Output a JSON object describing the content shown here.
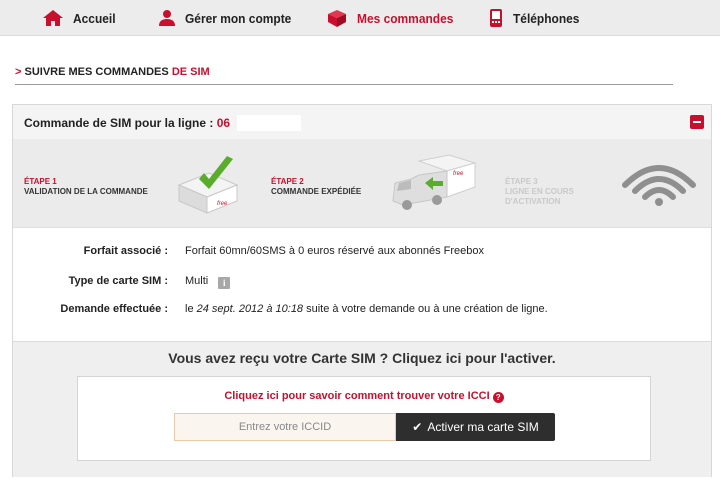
{
  "nav": {
    "items": [
      {
        "label": "Accueil",
        "icon": "home-icon"
      },
      {
        "label": "Gérer mon compte",
        "icon": "user-icon"
      },
      {
        "label": "Mes commandes",
        "icon": "box-icon"
      },
      {
        "label": "Téléphones",
        "icon": "phone-icon"
      }
    ],
    "active": "Mes commandes"
  },
  "section": {
    "arrow": ">",
    "title_main": "SUIVRE MES COMMANDES",
    "title_red": "DE SIM"
  },
  "panel": {
    "title": "Commande de SIM pour la ligne :",
    "line_number": "06",
    "steps": [
      {
        "num": "ÉTAPE 1",
        "lines": [
          "VALIDATION DE LA COMMANDE"
        ],
        "state": "done"
      },
      {
        "num": "ÉTAPE 2",
        "lines": [
          "COMMANDE EXPÉDIÉE"
        ],
        "state": "current"
      },
      {
        "num": "ÉTAPE 3",
        "lines": [
          "LIGNE EN COURS",
          "D'ACTIVATION"
        ],
        "state": "pending"
      }
    ],
    "details": {
      "forfait_label": "Forfait associé :",
      "forfait_value": "Forfait 60mn/60SMS à 0 euros réservé aux abonnés Freebox",
      "type_label": "Type de carte SIM :",
      "type_value": "Multi",
      "demande_label": "Demande effectuée :",
      "demande_prefix": "le",
      "demande_date": "24 sept. 2012 à 10:18",
      "demande_suffix": "suite à votre demande ou à une création de ligne."
    },
    "activation": {
      "title": "Vous avez reçu votre Carte SIM ? Cliquez ici pour l'activer.",
      "icci_link": "Cliquez ici pour savoir comment trouver votre ICCI",
      "iccid_placeholder": "Entrez votre ICCID",
      "button_label": "Activer ma carte SIM"
    }
  },
  "colors": {
    "accent": "#c8102e",
    "nav_bg": "#ececec",
    "button_bg": "#2e2e2e"
  }
}
